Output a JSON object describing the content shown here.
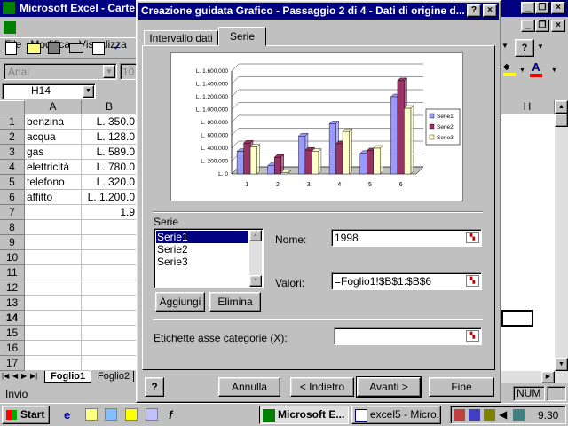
{
  "excel": {
    "title": "Microsoft Excel - Carte",
    "menu": [
      "File",
      "Modifica",
      "Visualizza"
    ],
    "font_name": "Arial",
    "font_size": "10",
    "name_box": "H14",
    "col_headers": [
      "A",
      "B"
    ],
    "right_col_header": "H",
    "rows": [
      {
        "n": "1",
        "a": "benzina",
        "b": "L. 350.0"
      },
      {
        "n": "2",
        "a": "acqua",
        "b": "L. 128.0"
      },
      {
        "n": "3",
        "a": "gas",
        "b": "L. 589.0"
      },
      {
        "n": "4",
        "a": "elettricità",
        "b": "L. 780.0"
      },
      {
        "n": "5",
        "a": "telefono",
        "b": "L. 320.0"
      },
      {
        "n": "6",
        "a": "affitto",
        "b": "L. 1.200.0"
      },
      {
        "n": "7",
        "a": "",
        "b": "1.9"
      },
      {
        "n": "8",
        "a": "",
        "b": ""
      },
      {
        "n": "9",
        "a": "",
        "b": ""
      },
      {
        "n": "10",
        "a": "",
        "b": ""
      },
      {
        "n": "11",
        "a": "",
        "b": ""
      },
      {
        "n": "12",
        "a": "",
        "b": ""
      },
      {
        "n": "13",
        "a": "",
        "b": ""
      },
      {
        "n": "14",
        "a": "",
        "b": ""
      },
      {
        "n": "15",
        "a": "",
        "b": ""
      },
      {
        "n": "16",
        "a": "",
        "b": ""
      },
      {
        "n": "17",
        "a": "",
        "b": ""
      }
    ],
    "sheet_tabs": [
      "Foglio1",
      "Foglio2"
    ],
    "status_left": "Invio",
    "status_num": "NUM"
  },
  "dialog": {
    "title": "Creazione guidata Grafico - Passaggio 2 di 4 - Dati di origine d...",
    "tabs": [
      "Intervallo dati",
      "Serie"
    ],
    "series_group_label": "Serie",
    "series_list": [
      "Serie1",
      "Serie2",
      "Serie3"
    ],
    "name_label": "Nome:",
    "name_value": "1998",
    "values_label": "Valori:",
    "values_value": "=Foglio1!$B$1:$B$6",
    "add_button": "Aggiungi",
    "remove_button": "Elimina",
    "category_label": "Etichette asse categorie (X):",
    "category_value": "",
    "cancel_button": "Annulla",
    "back_button": "< Indietro",
    "next_button": "Avanti >",
    "finish_button": "Fine"
  },
  "chart_data": {
    "type": "bar",
    "categories": [
      "1",
      "2",
      "3",
      "4",
      "5",
      "6"
    ],
    "series": [
      {
        "name": "Serie1",
        "values": [
          350000,
          128000,
          589000,
          780000,
          320000,
          1200000
        ],
        "color": "#9999ff"
      },
      {
        "name": "Serie2",
        "values": [
          480000,
          260000,
          370000,
          470000,
          360000,
          1450000
        ],
        "color": "#993366"
      },
      {
        "name": "Serie3",
        "values": [
          420000,
          20000,
          350000,
          660000,
          400000,
          1020000
        ],
        "color": "#ffffcc"
      }
    ],
    "y_ticks": [
      "L. 0",
      "L. 200.000",
      "L. 400.000",
      "L. 600.000",
      "L. 800.000",
      "L. 1.000.000",
      "L. 1.200.000",
      "L. 1.400.000",
      "L. 1.600.000"
    ],
    "ylim": [
      0,
      1600000
    ],
    "legend_position": "right"
  },
  "taskbar": {
    "start": "Start",
    "tasks": [
      "Microsoft E...",
      "excel5 - Micro..."
    ],
    "clock": "9.30"
  }
}
